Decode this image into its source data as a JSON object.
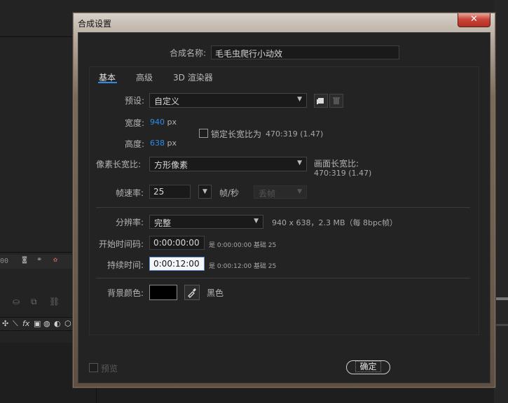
{
  "background": {
    "timecode": "00",
    "tool_icons": [
      "✣",
      "⟍",
      "fx",
      "▣",
      "◍",
      "◐",
      "⬡"
    ]
  },
  "dialog": {
    "title": "合成设置",
    "close_glyph": "✕",
    "comp_name_label": "合成名称:",
    "comp_name_value": "毛毛虫爬行小动效",
    "tabs": [
      {
        "label": "基本",
        "active": true
      },
      {
        "label": "高级",
        "active": false
      },
      {
        "label": "3D 渲染器",
        "active": false
      }
    ],
    "preset": {
      "label": "预设:",
      "value": "自定义"
    },
    "width": {
      "label": "宽度:",
      "value": "940",
      "unit": "px"
    },
    "height": {
      "label": "高度:",
      "value": "638",
      "unit": "px"
    },
    "lock_aspect": {
      "label": "锁定长宽比为",
      "ratio": "470:319 (1.47)",
      "checked": false
    },
    "pixel_aspect": {
      "label": "像素长宽比:",
      "value": "方形像素"
    },
    "frame_aspect": {
      "label": "画面长宽比:",
      "value": "470:319 (1.47)"
    },
    "frame_rate": {
      "label": "帧速率:",
      "value": "25",
      "unit": "帧/秒",
      "drop_frame": "丢帧"
    },
    "resolution": {
      "label": "分辨率:",
      "value": "完整",
      "info": "940 x 638，2.3 MB（每 8bpc帧）"
    },
    "start_timecode": {
      "label": "开始时间码:",
      "value": "0:00:00:00",
      "note": "是 0:00:00:00  基础 25"
    },
    "duration": {
      "label": "持续时间:",
      "value": "0:00:12:00",
      "note": "是 0:00:12:00  基础 25"
    },
    "bg_color": {
      "label": "背景颜色:",
      "color": "#000000",
      "name": "黑色"
    },
    "preview": {
      "label": "预览",
      "checked": false
    },
    "ok_label": "确定"
  },
  "colors": {
    "accent": "#2d8ceb",
    "panel": "#232323",
    "close_red": "#c9453a"
  }
}
